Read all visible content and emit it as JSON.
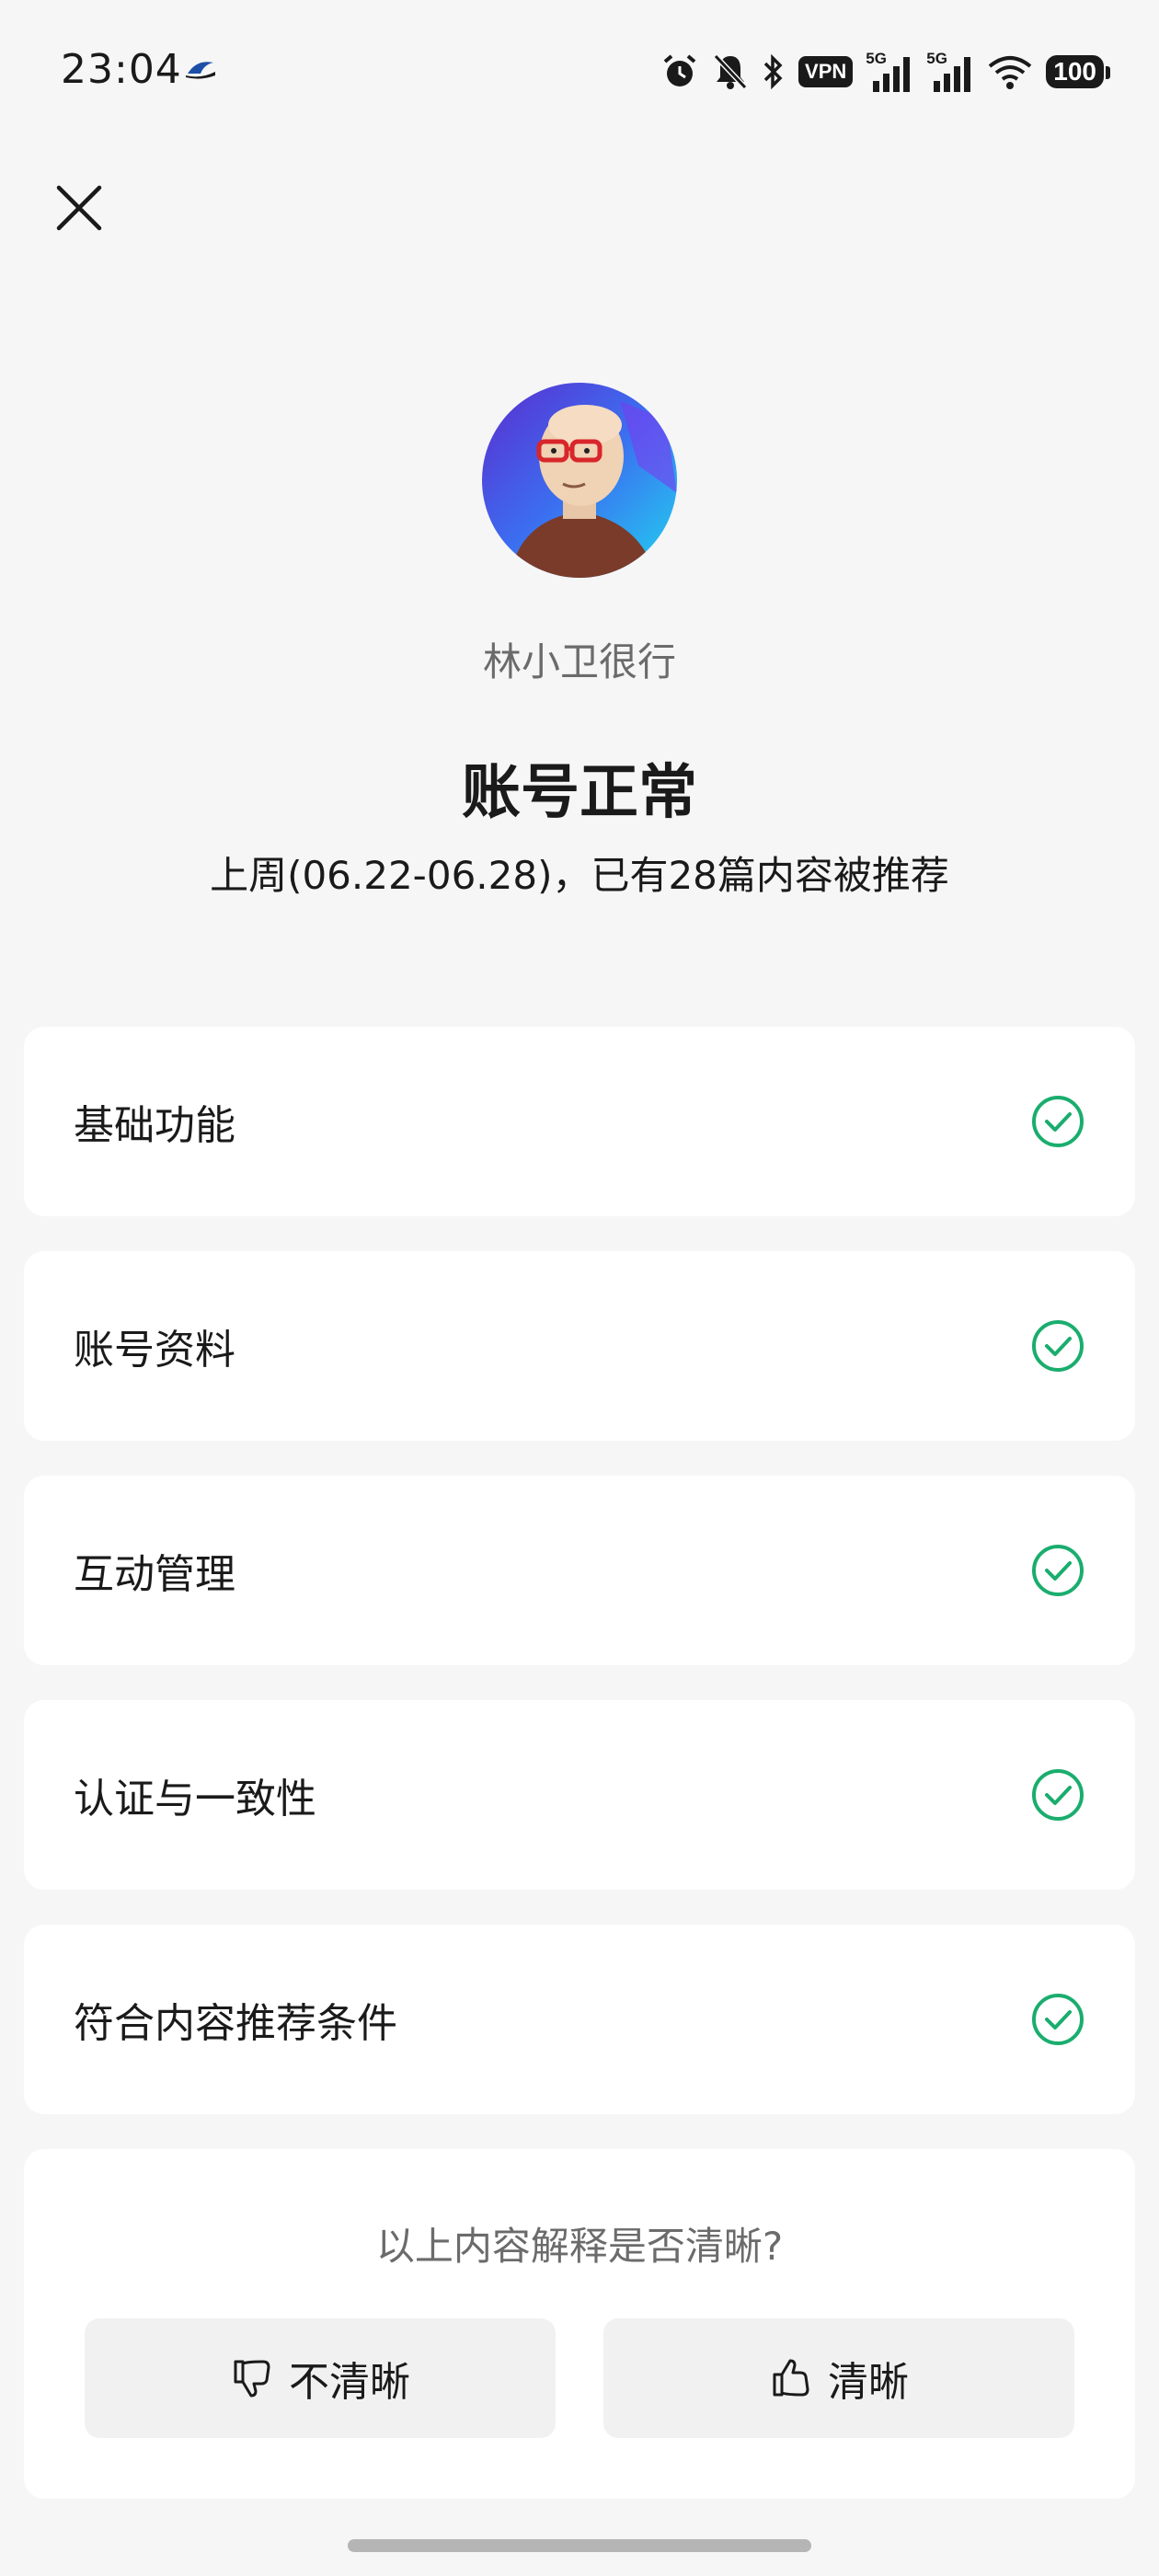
{
  "status_bar": {
    "time": "23:04",
    "vpn_label": "VPN",
    "signal1_label": "5G",
    "signal2_label": "5G",
    "battery_level": "100",
    "icons": [
      "alarm-icon",
      "bell-off-icon",
      "bluetooth-icon",
      "vpn-icon",
      "signal-icon",
      "signal-icon",
      "wifi-icon",
      "battery-icon"
    ]
  },
  "profile": {
    "name": "林小卫很行",
    "status_title": "账号正常",
    "status_desc": "上周(06.22-06.28)，已有28篇内容被推荐"
  },
  "checks": [
    {
      "label": "基础功能",
      "status": "pass"
    },
    {
      "label": "账号资料",
      "status": "pass"
    },
    {
      "label": "互动管理",
      "status": "pass"
    },
    {
      "label": "认证与一致性",
      "status": "pass"
    },
    {
      "label": "符合内容推荐条件",
      "status": "pass"
    }
  ],
  "feedback": {
    "question": "以上内容解释是否清晰?",
    "unclear_label": "不清晰",
    "clear_label": "清晰"
  },
  "colors": {
    "accent_green": "#1aad6e",
    "background": "#f6f6f6",
    "card": "#ffffff"
  }
}
